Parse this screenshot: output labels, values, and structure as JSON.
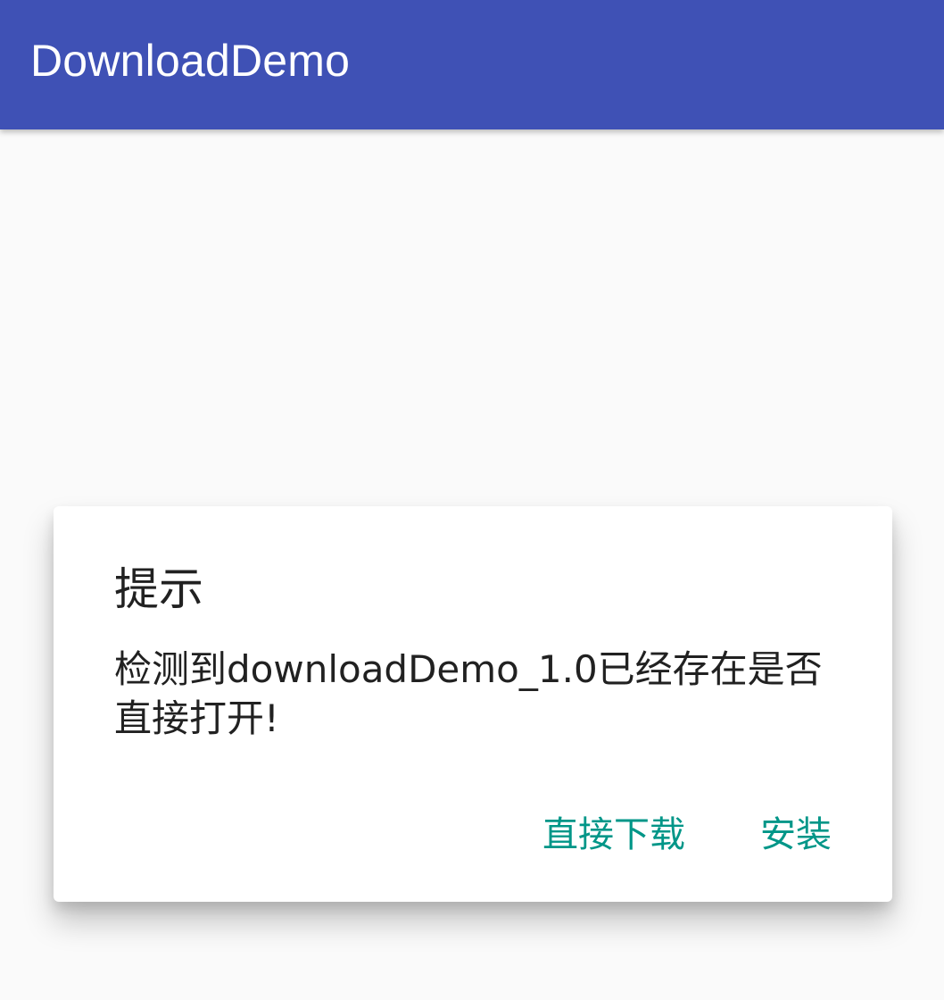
{
  "app_bar": {
    "title": "DownloadDemo"
  },
  "dialog": {
    "title": "提示",
    "message": "检测到downloadDemo_1.0已经存在是否直接打开!",
    "buttons": {
      "download_direct": "直接下载",
      "install": "安装"
    }
  },
  "colors": {
    "primary": "#3f51b5",
    "accent": "#009688",
    "background": "#fafafa",
    "dialog_background": "#ffffff",
    "text_primary": "#212121"
  }
}
